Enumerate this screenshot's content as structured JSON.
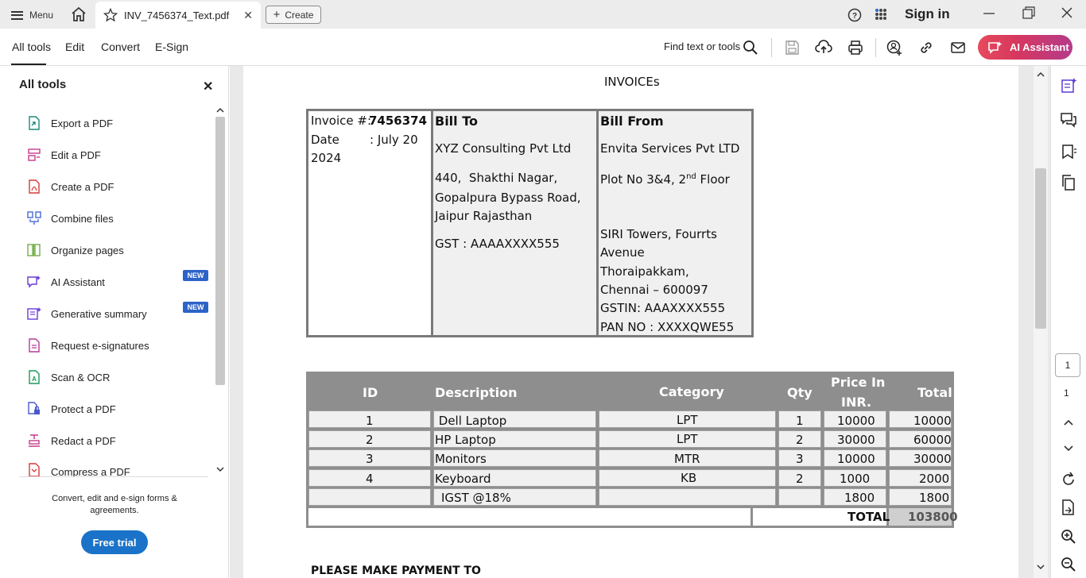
{
  "titlebar": {
    "menu_label": "Menu",
    "tab_title": "INV_7456374_Text.pdf",
    "create_label": "Create",
    "signin_label": "Sign in"
  },
  "toolbar": {
    "tabs": [
      "All tools",
      "Edit",
      "Convert",
      "E-Sign"
    ],
    "find_label": "Find text or tools",
    "ai_label": "AI Assistant"
  },
  "sidebar": {
    "title": "All tools",
    "items": [
      "Export a PDF",
      "Edit a PDF",
      "Create a PDF",
      "Combine files",
      "Organize pages",
      "AI Assistant",
      "Generative summary",
      "Request e-signatures",
      "Scan & OCR",
      "Protect a PDF",
      "Redact a PDF",
      "Compress a PDF"
    ],
    "new_badge": "NEW",
    "promo": "Convert, edit and e-sign forms & agreements.",
    "trial_label": "Free trial"
  },
  "page_nav": {
    "current": "1",
    "total": "1"
  },
  "invoice": {
    "heading": "INVOICEs",
    "invoice_label": "Invoice #: ",
    "invoice_no": "7456374",
    "date_line1": "Date        : July 20",
    "date_line2": "2024",
    "bill_to": {
      "title": "Bill To",
      "name": "XYZ Consulting Pvt Ltd",
      "addr1": "440,  Shakthi Nagar,",
      "addr2": "Gopalpura Bypass Road,",
      "addr3": "Jaipur Rajasthan",
      "gst": "GST : AAAAXXXX555"
    },
    "bill_from": {
      "title": "Bill From",
      "name": "Envita Services Pvt LTD",
      "addr1_pre": "Plot No 3&4, 2",
      "addr1_sup": "nd",
      "addr1_post": " Floor",
      "addr2": "SIRI Towers, Fourrts",
      "addr3": "Avenue",
      "addr4": "Thoraipakkam,",
      "addr5": "Chennai – 600097",
      "gstin": "GSTIN: AAAXXXX555",
      "pan": "PAN NO : XXXXQWE55"
    },
    "headers": {
      "id": "ID",
      "desc": "Description",
      "cat": "Category",
      "qty": "Qty",
      "price1": "Price In",
      "price2": "INR.",
      "total": "Total"
    },
    "rows": [
      {
        "id": "1",
        "desc": " Dell Laptop",
        "cat": "LPT",
        "qty": "1",
        "price": "10000",
        "total": "10000"
      },
      {
        "id": "2",
        "desc": "HP Laptop",
        "cat": "LPT",
        "qty": "2",
        "price": "30000",
        "total": "60000"
      },
      {
        "id": "3",
        "desc": "Monitors",
        "cat": "MTR",
        "qty": "3",
        "price": "10000",
        "total": "30000"
      },
      {
        "id": "4",
        "desc": "Keyboard",
        "cat": "KB",
        "qty": "2",
        "price": "1000",
        "total": "2000"
      }
    ],
    "tax": {
      "label": "IGST @18%",
      "price": "1800",
      "total": "1800"
    },
    "grand": {
      "label": "TOTAL",
      "value": "103800"
    },
    "payment_heading": "PLEASE MAKE PAYMENT TO"
  }
}
